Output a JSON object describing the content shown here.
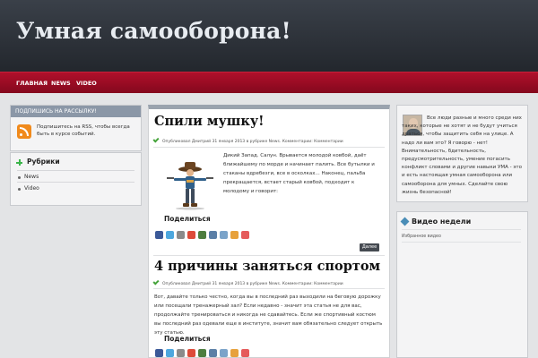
{
  "site": {
    "title": "Умная самооборона!"
  },
  "nav": {
    "items": [
      "ГЛАВНАЯ",
      "NEWS",
      "VIDEO"
    ]
  },
  "subscribe": {
    "heading": "ПОДПИШИСЬ НА РАССЫЛКУ!",
    "text": "Подпишитесь на RSS, чтобы всегда быть в курсе событий."
  },
  "rubrics": {
    "title": "Рубрики",
    "items": [
      "News",
      "Video"
    ]
  },
  "posts": [
    {
      "title": "Спили мушку!",
      "meta": "Опубликовал Дмитрий 31 января 2013 в рубрике News. Комментарии: Комментарии",
      "excerpt": "Дикий Запад. Салун. Врывается молодой ковбой, даёт ближайшему по морде и начинает палить. Все бутылки и стаканы вдребезги, все в осколках... Наконец, пальба прекращается, встает старый ковбой, подходит к молодому и говорит:",
      "share": "Поделиться",
      "more": "Далее"
    },
    {
      "title": "4 причины заняться спортом",
      "meta": "Опубликовал Дмитрий 31 января 2013 в рубрике News. Комментарии: Комментарии",
      "excerpt": "Вот, давайте только честно, когда вы в последний раз выходили на беговую дорожку или посещали тренажерный зал? Если недавно - значит эта статья не для вас, продолжайте тренироваться и никогда не сдавайтесь. Если же спортивный костюм вы последний раз одевали еще в институте, значит вам обязательно следует открыть эту статью.",
      "share": "Поделиться"
    }
  ],
  "about": {
    "text": "Все люди разные и много среди них таких, которые не хотят и не будут учиться драться, чтобы защитить себя на улице. А надо ли вам это? Я говорю - нет! Внимательность, бдительность, предусмотрительность, умение погасить конфликт словами и другие навыки УМА - это и есть настоящая умная самооборона или самооборона для умных. Сделайте свою жизнь безопасной!"
  },
  "video_widget": {
    "title": "Видео недели",
    "subtitle": "Избранное видео"
  },
  "colors": {
    "nav_red": "#a50d27",
    "accent_green": "#3bb54a",
    "header_dark": "#2b2f35"
  },
  "icons": [
    "rss-icon",
    "plus-icon",
    "check-icon",
    "video-icon",
    "share-icons"
  ]
}
